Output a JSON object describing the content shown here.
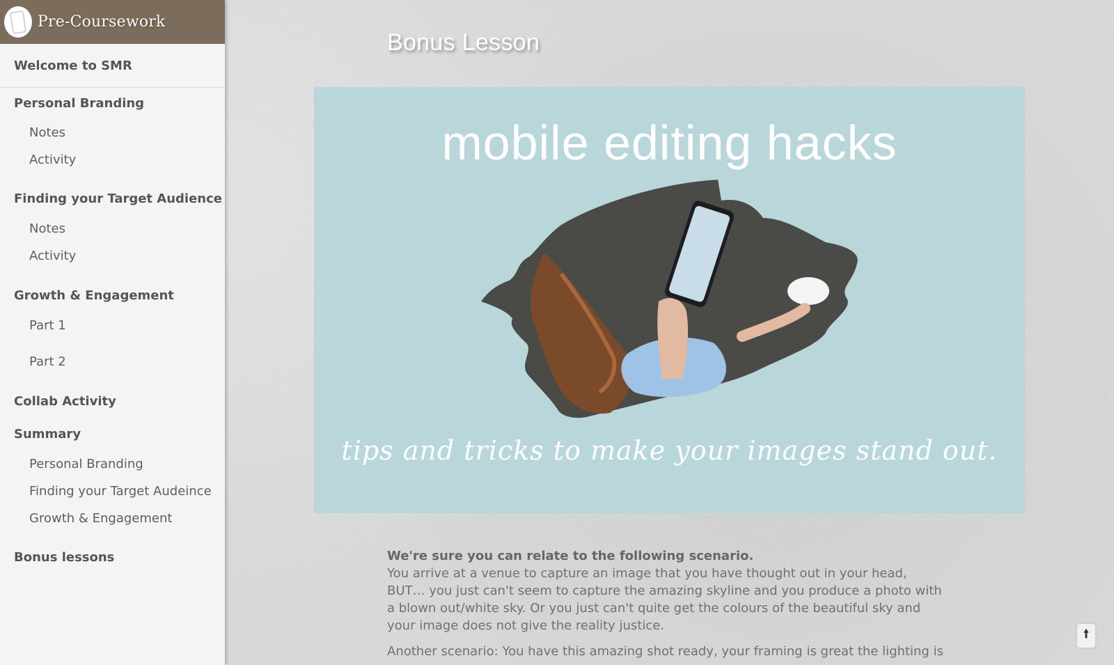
{
  "sidebar": {
    "brand_title": "Pre-Coursework",
    "logo_icon": "tablet-icon",
    "welcome": "Welcome to SMR",
    "sections": {
      "personal_branding": {
        "label": "Personal Branding",
        "items": [
          "Notes",
          "Activity"
        ]
      },
      "target_audience": {
        "label": "Finding your Target Audience",
        "items": [
          "Notes",
          "Activity"
        ]
      },
      "growth": {
        "label": "Growth & Engagement",
        "items": [
          "Part 1",
          "Part 2"
        ]
      },
      "collab": {
        "label": "Collab Activity"
      },
      "summary": {
        "label": "Summary",
        "items": [
          "Personal Branding",
          "Finding your Target Audeince",
          "Growth & Engagement"
        ]
      },
      "bonus": {
        "label": "Bonus lessons"
      }
    }
  },
  "main": {
    "page_title": "Bonus Lesson",
    "hero": {
      "heading": "mobile editing hacks",
      "tagline": "tips and tricks to make your images stand out.",
      "background_color": "#b9d7da"
    },
    "intro_heading": "We're sure you can relate to the following scenario.",
    "paragraph_1": "You arrive at a venue to capture an image that you have thought out in your head, BUT… you just can't seem to capture the amazing skyline and you produce a photo with a blown out/white sky. Or you just can't quite get the colours of the beautiful sky and your image does not give the reality justice.",
    "paragraph_2": "Another scenario: You have this amazing shot ready, your framing is great the lighting is awesome,"
  },
  "scroll_top_icon": "arrow-up-icon",
  "colors": {
    "sidebar_header": "#7b6c5b",
    "sidebar_bg": "#f4f4f4",
    "text": "#707070"
  }
}
